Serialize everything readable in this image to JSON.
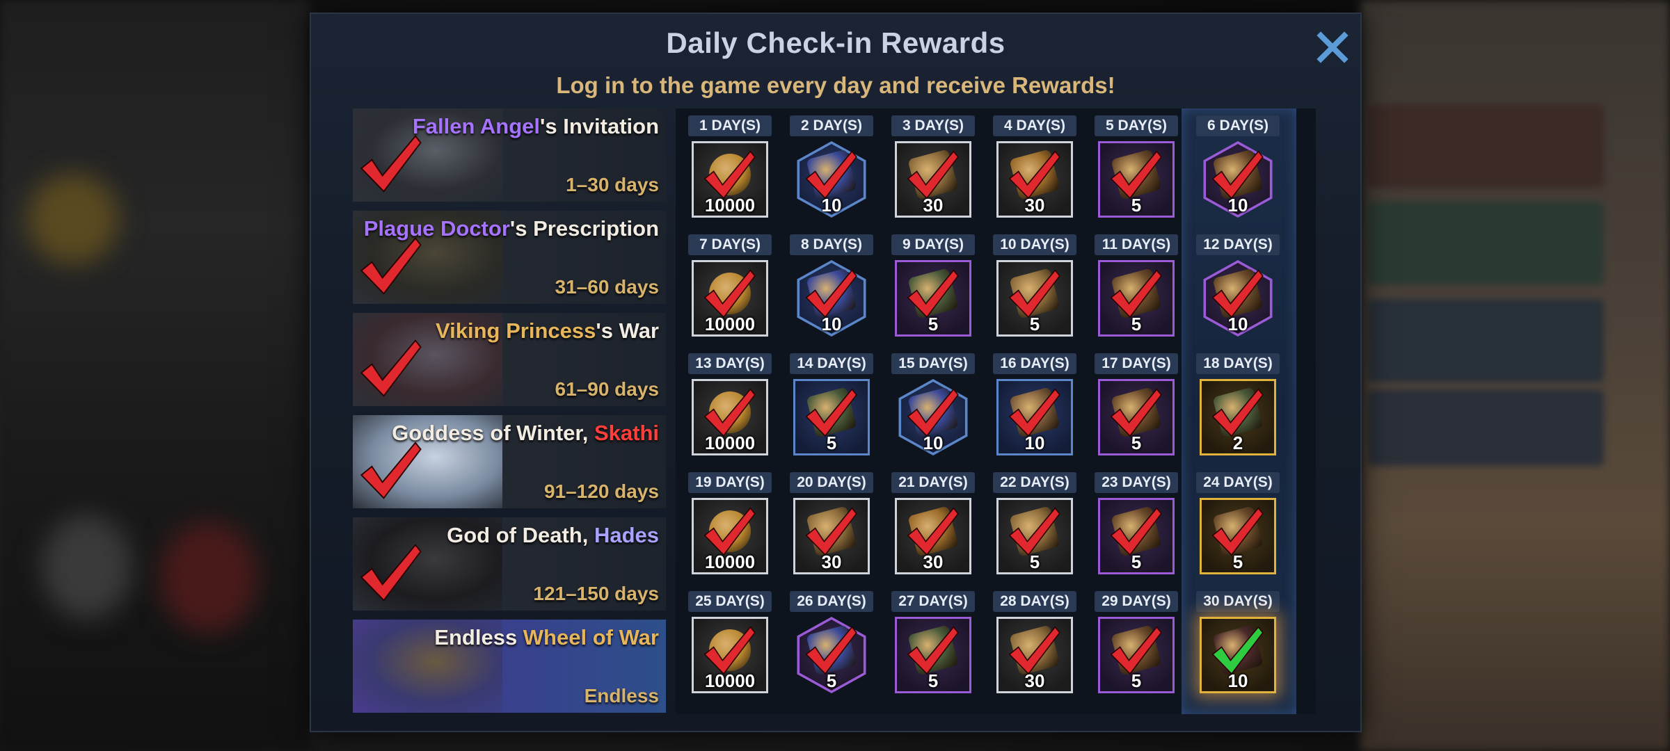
{
  "dialog": {
    "title": "Daily Check-in Rewards",
    "subtitle": "Log in to the game every day and receive Rewards!",
    "close_icon": "close-icon"
  },
  "colors": {
    "accent_gold": "#d9b77a",
    "check_red": "#e0282e",
    "check_green": "#2ecc40",
    "rarity_white": "#d0d4da",
    "rarity_blue": "#5b86c9",
    "rarity_purple": "#9b5bd6",
    "rarity_gold": "#e1b23c"
  },
  "stages": [
    {
      "parts": [
        {
          "t": "Fallen Angel",
          "c": "c-purple"
        },
        {
          "t": "'s Invitation",
          "c": ""
        }
      ],
      "range": "1–30 days",
      "claimed": true
    },
    {
      "parts": [
        {
          "t": "Plague Doctor",
          "c": "c-purple"
        },
        {
          "t": "'s Prescription",
          "c": ""
        }
      ],
      "range": "31–60 days",
      "claimed": true
    },
    {
      "parts": [
        {
          "t": "Viking Princess",
          "c": "c-gold"
        },
        {
          "t": "'s War",
          "c": ""
        }
      ],
      "range": "61–90 days",
      "claimed": true
    },
    {
      "parts": [
        {
          "t": "Goddess of Winter, ",
          "c": ""
        },
        {
          "t": "Skathi",
          "c": "c-red"
        }
      ],
      "range": "91–120 days",
      "claimed": true
    },
    {
      "parts": [
        {
          "t": "God of Death, ",
          "c": ""
        },
        {
          "t": "Hades",
          "c": "c-lav"
        }
      ],
      "range": "121–150 days",
      "claimed": true
    },
    {
      "parts": [
        {
          "t": "Endless ",
          "c": ""
        },
        {
          "t": "Wheel of War",
          "c": "c-gold"
        }
      ],
      "range": "Endless",
      "claimed": false
    }
  ],
  "days": [
    {
      "label": "1 DAY(S)",
      "qty": "10000",
      "rarity": "white",
      "shape": "square",
      "icon": "coin-icon",
      "status": "claimed"
    },
    {
      "label": "2 DAY(S)",
      "qty": "10",
      "rarity": "blue",
      "shape": "hex",
      "icon": "potion-icon",
      "status": "claimed"
    },
    {
      "label": "3 DAY(S)",
      "qty": "30",
      "rarity": "white",
      "shape": "square",
      "icon": "scroll-icon",
      "status": "claimed"
    },
    {
      "label": "4 DAY(S)",
      "qty": "30",
      "rarity": "white",
      "shape": "square",
      "icon": "chalice-icon",
      "status": "claimed"
    },
    {
      "label": "5 DAY(S)",
      "qty": "5",
      "rarity": "purple",
      "shape": "square",
      "icon": "ore-icon",
      "status": "claimed"
    },
    {
      "label": "6 DAY(S)",
      "qty": "10",
      "rarity": "purple",
      "shape": "hex",
      "icon": "ore-icon",
      "status": "claimed"
    },
    {
      "label": "7 DAY(S)",
      "qty": "10000",
      "rarity": "white",
      "shape": "square",
      "icon": "coin-icon",
      "status": "claimed"
    },
    {
      "label": "8 DAY(S)",
      "qty": "10",
      "rarity": "blue",
      "shape": "hex",
      "icon": "potion-icon",
      "status": "claimed"
    },
    {
      "label": "9 DAY(S)",
      "qty": "5",
      "rarity": "purple",
      "shape": "square",
      "icon": "book-icon",
      "status": "claimed"
    },
    {
      "label": "10 DAY(S)",
      "qty": "5",
      "rarity": "white",
      "shape": "square",
      "icon": "scroll-icon",
      "status": "claimed"
    },
    {
      "label": "11 DAY(S)",
      "qty": "5",
      "rarity": "purple",
      "shape": "square",
      "icon": "ore-icon",
      "status": "claimed"
    },
    {
      "label": "12 DAY(S)",
      "qty": "10",
      "rarity": "purple",
      "shape": "hex",
      "icon": "ore-icon",
      "status": "claimed"
    },
    {
      "label": "13 DAY(S)",
      "qty": "10000",
      "rarity": "white",
      "shape": "square",
      "icon": "coin-icon",
      "status": "claimed"
    },
    {
      "label": "14 DAY(S)",
      "qty": "5",
      "rarity": "blue",
      "shape": "square",
      "icon": "book-icon",
      "status": "claimed"
    },
    {
      "label": "15 DAY(S)",
      "qty": "10",
      "rarity": "blue",
      "shape": "hex",
      "icon": "potion-icon",
      "status": "claimed"
    },
    {
      "label": "16 DAY(S)",
      "qty": "10",
      "rarity": "blue",
      "shape": "square",
      "icon": "stone-icon",
      "status": "claimed"
    },
    {
      "label": "17 DAY(S)",
      "qty": "5",
      "rarity": "purple",
      "shape": "square",
      "icon": "ore-icon",
      "status": "claimed"
    },
    {
      "label": "18 DAY(S)",
      "qty": "2",
      "rarity": "gold",
      "shape": "square",
      "icon": "book-icon",
      "status": "claimed"
    },
    {
      "label": "19 DAY(S)",
      "qty": "10000",
      "rarity": "white",
      "shape": "square",
      "icon": "coin-icon",
      "status": "claimed"
    },
    {
      "label": "20 DAY(S)",
      "qty": "30",
      "rarity": "white",
      "shape": "square",
      "icon": "scroll-icon",
      "status": "claimed"
    },
    {
      "label": "21 DAY(S)",
      "qty": "30",
      "rarity": "white",
      "shape": "square",
      "icon": "chalice-icon",
      "status": "claimed"
    },
    {
      "label": "22 DAY(S)",
      "qty": "5",
      "rarity": "white",
      "shape": "square",
      "icon": "scroll-icon",
      "status": "claimed"
    },
    {
      "label": "23 DAY(S)",
      "qty": "5",
      "rarity": "purple",
      "shape": "square",
      "icon": "ore-icon",
      "status": "claimed"
    },
    {
      "label": "24 DAY(S)",
      "qty": "5",
      "rarity": "gold",
      "shape": "square",
      "icon": "ore-icon",
      "status": "claimed"
    },
    {
      "label": "25 DAY(S)",
      "qty": "10000",
      "rarity": "white",
      "shape": "square",
      "icon": "coin-icon",
      "status": "claimed"
    },
    {
      "label": "26 DAY(S)",
      "qty": "5",
      "rarity": "purple",
      "shape": "hex",
      "icon": "potion-icon",
      "status": "claimed"
    },
    {
      "label": "27 DAY(S)",
      "qty": "5",
      "rarity": "purple",
      "shape": "square",
      "icon": "book-icon",
      "status": "claimed"
    },
    {
      "label": "28 DAY(S)",
      "qty": "30",
      "rarity": "white",
      "shape": "square",
      "icon": "scroll-icon",
      "status": "claimed"
    },
    {
      "label": "29 DAY(S)",
      "qty": "5",
      "rarity": "purple",
      "shape": "square",
      "icon": "ore-icon",
      "status": "claimed"
    },
    {
      "label": "30 DAY(S)",
      "qty": "10",
      "rarity": "gold",
      "shape": "square",
      "icon": "card-icon",
      "status": "today"
    }
  ]
}
